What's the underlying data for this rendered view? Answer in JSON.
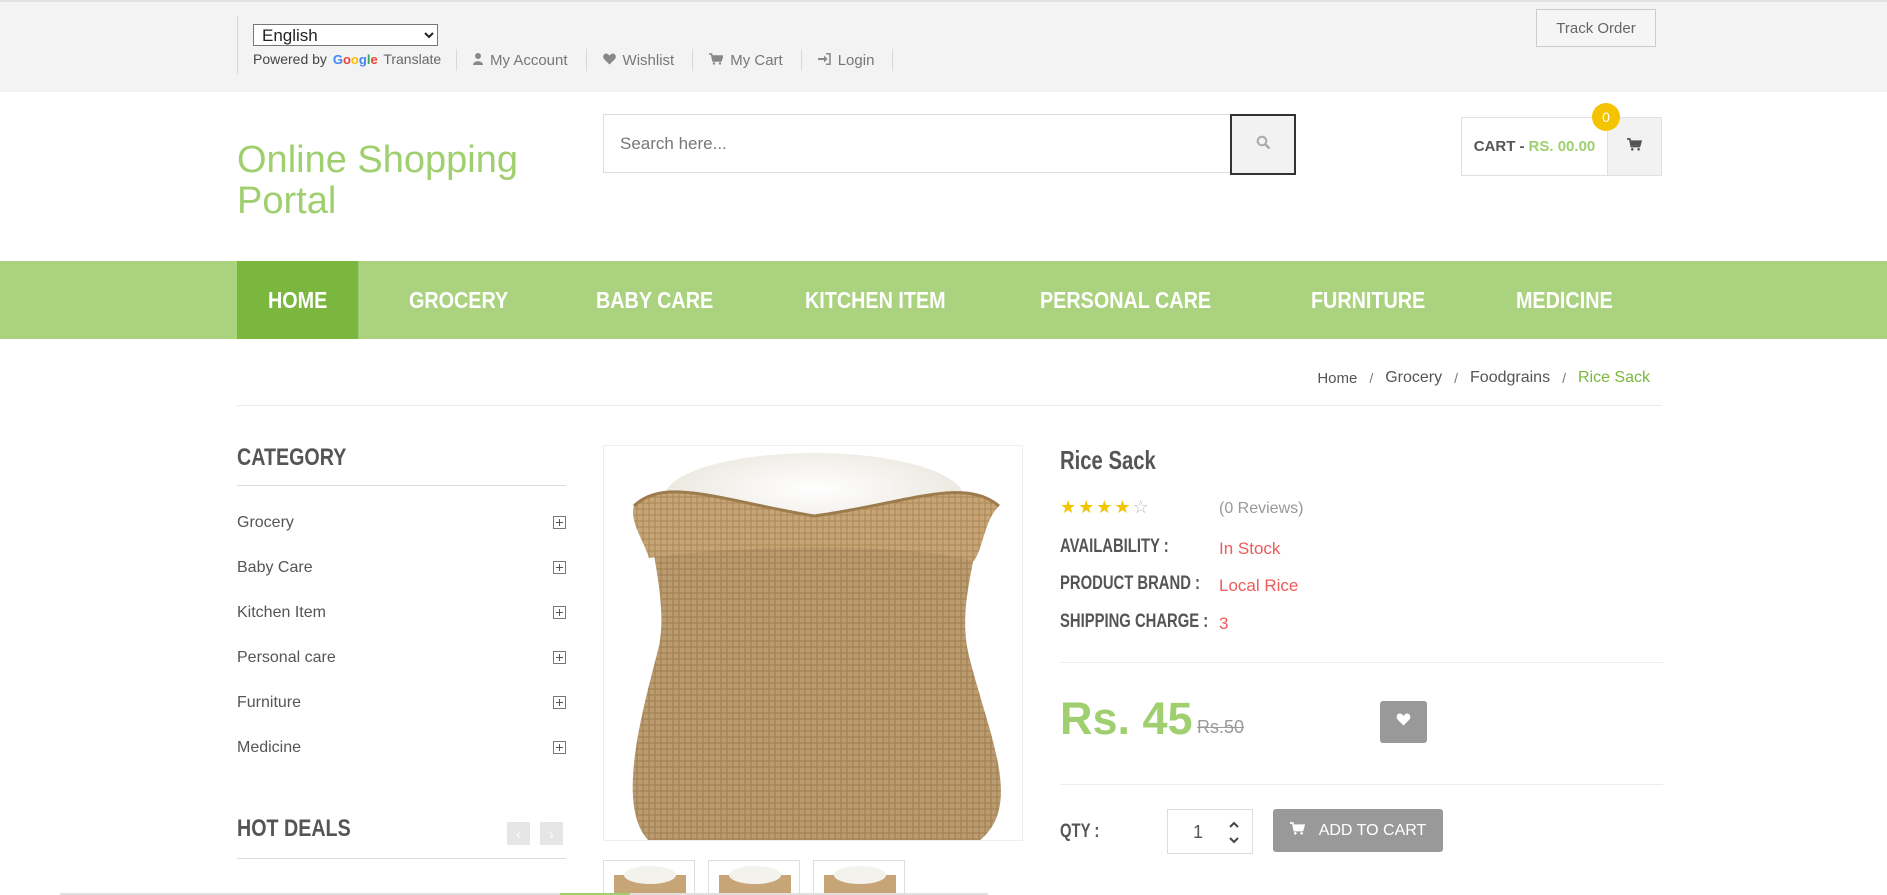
{
  "topbar": {
    "language": {
      "selected": "English",
      "options": [
        "English"
      ]
    },
    "powered_by": "Powered by",
    "google": "Google",
    "translate": "Translate",
    "links": [
      {
        "label": "My Account",
        "icon": "user-icon"
      },
      {
        "label": "Wishlist",
        "icon": "heart-icon"
      },
      {
        "label": "My Cart",
        "icon": "cart-icon"
      },
      {
        "label": "Login",
        "icon": "sign-in-icon"
      }
    ],
    "track_order": "Track Order"
  },
  "header": {
    "brand": "Online Shopping Portal",
    "search_placeholder": "Search here...",
    "cart_label": "CART -",
    "cart_amount": "RS. 00.00",
    "cart_count": "0"
  },
  "nav": {
    "items": [
      "HOME",
      "GROCERY",
      "BABY CARE",
      "KITCHEN ITEM",
      "PERSONAL CARE",
      "FURNITURE",
      "MEDICINE"
    ],
    "active": "HOME"
  },
  "breadcrumb": {
    "items": [
      "Home",
      "Grocery",
      "Foodgrains"
    ],
    "current": "Rice Sack",
    "separator": "/"
  },
  "sidebar": {
    "category_title": "CATEGORY",
    "categories": [
      "Grocery",
      "Baby Care",
      "Kitchen Item",
      "Personal care",
      "Furniture",
      "Medicine"
    ],
    "hot_deals_title": "HOT DEALS"
  },
  "product": {
    "name": "Rice Sack",
    "rating": 4,
    "rating_max": 5,
    "reviews": "(0 Reviews)",
    "availability_label": "AVAILABILITY :",
    "availability": "In Stock",
    "brand_label": "PRODUCT BRAND :",
    "brand": "Local Rice",
    "shipping_label": "SHIPPING CHARGE :",
    "shipping": "3",
    "price": "Rs. 45",
    "old_price": "Rs.50",
    "qty_label": "QTY :",
    "qty": "1",
    "add_to_cart": "ADD TO CART"
  },
  "colors": {
    "accent_green": "#9fcf6e",
    "nav_green": "#abd27e",
    "nav_active": "#7bb73f",
    "value_red": "#ef5a5a",
    "star_yellow": "#f5c400",
    "badge_yellow": "#f5c400"
  }
}
